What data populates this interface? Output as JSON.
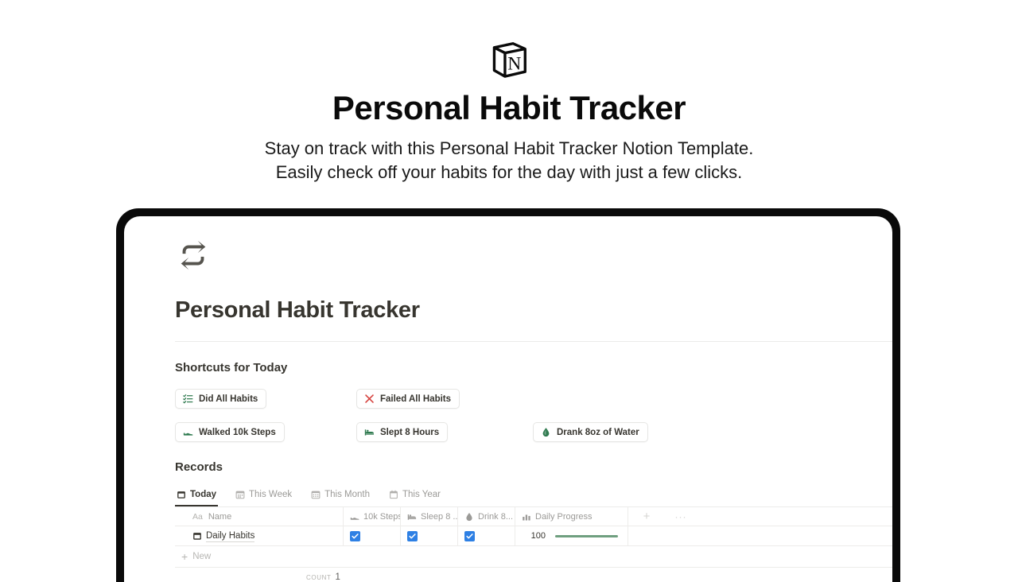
{
  "hero": {
    "logo_icon": "notion-cube-icon",
    "title": "Personal Habit Tracker",
    "subtitle_line1": "Stay on track with this Personal Habit Tracker Notion Template.",
    "subtitle_line2": "Easily check off your habits for the day with just a few clicks."
  },
  "page": {
    "icon": "repeat-icon",
    "title": "Personal Habit Tracker"
  },
  "shortcuts": {
    "heading": "Shortcuts for Today",
    "buttons": [
      {
        "label": "Did All Habits",
        "icon": "checklist-icon",
        "color": "#2f7a4f"
      },
      {
        "label": "Failed All Habits",
        "icon": "x-mark-icon",
        "color": "#d64541"
      },
      {
        "label": "Walked 10k Steps",
        "icon": "shoe-icon",
        "color": "#2f7a4f"
      },
      {
        "label": "Slept 8 Hours",
        "icon": "bed-icon",
        "color": "#2f7a4f"
      },
      {
        "label": "Drank 8oz of Water",
        "icon": "water-drop-icon",
        "color": "#2f7a4f"
      }
    ]
  },
  "records": {
    "heading": "Records",
    "tabs": [
      {
        "label": "Today",
        "icon": "calendar-icon",
        "active": true
      },
      {
        "label": "This Week",
        "icon": "calendar-icon",
        "active": false
      },
      {
        "label": "This Month",
        "icon": "calendar-icon",
        "active": false
      },
      {
        "label": "This Year",
        "icon": "calendar-icon",
        "active": false
      }
    ],
    "table": {
      "columns": {
        "name_prefix": "Aa",
        "name": "Name",
        "steps": "10k Steps",
        "sleep": "Sleep 8 ...",
        "drink": "Drink 8...",
        "progress": "Daily Progress",
        "add": "+",
        "more": "···"
      },
      "row": {
        "name": "Daily Habits",
        "name_icon": "calendar-icon",
        "steps_checked": true,
        "sleep_checked": true,
        "drink_checked": true,
        "progress_value": "100",
        "progress_percent": 100
      },
      "new_label": "New",
      "count_label": "Count",
      "count_value": "1"
    }
  },
  "colors": {
    "accent_blue": "#2e80e4",
    "progress_green": "#6f9f7f",
    "icon_green": "#2f7a4f",
    "icon_red": "#d64541",
    "text_dark": "#37352f",
    "text_muted": "#9b9a97"
  }
}
